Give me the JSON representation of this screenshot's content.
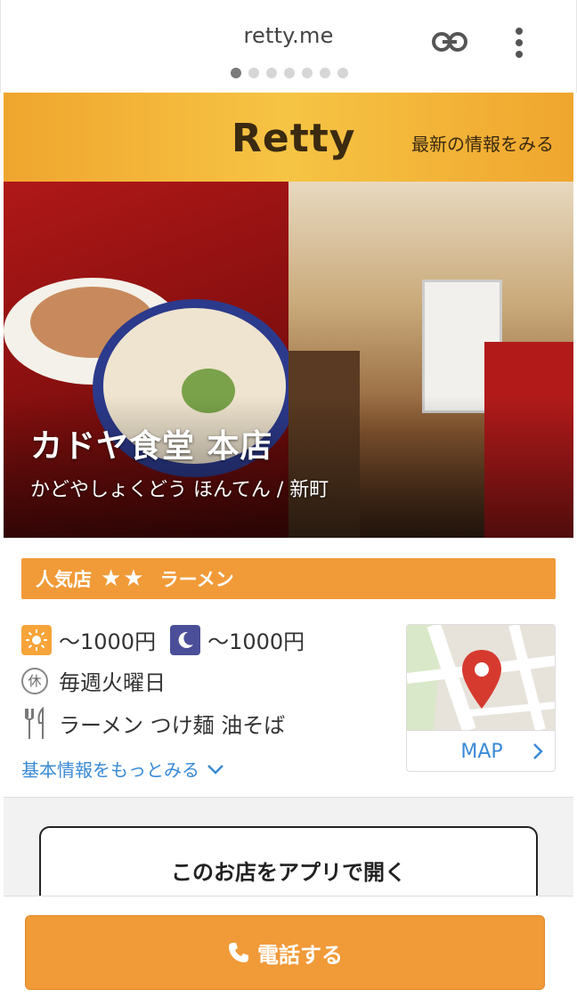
{
  "browser": {
    "url": "retty.me",
    "page_dots_count": 7,
    "active_dot_index": 0
  },
  "header": {
    "logo": "Retty",
    "latest_link": "最新の情報をみる"
  },
  "hero": {
    "shop_name": "カドヤ食堂 本店",
    "shop_kana": "かどやしょくどう ほんてん / 新町"
  },
  "badge": {
    "label": "人気店",
    "stars": "★★",
    "genre": "ラーメン"
  },
  "info": {
    "lunch_price": "～1000円",
    "dinner_price": "～1000円",
    "closed_icon_char": "休",
    "closed_day": "毎週火曜日",
    "genres": "ラーメン つけ麺 油そば",
    "more_info": "基本情報をもっとみる"
  },
  "map": {
    "label": "MAP"
  },
  "actions": {
    "open_in_app": "このお店をアプリで開く",
    "call": "電話する"
  },
  "colors": {
    "brand_orange": "#f19a38",
    "header_yellow": "#f6c444",
    "link_blue": "#3a8ad6",
    "moon_blue": "#4b4e98",
    "map_pin_red": "#d63a2f"
  },
  "icons": [
    "link-icon",
    "more-vert-icon",
    "sun-icon",
    "moon-icon",
    "closed-icon",
    "fork-knife-icon",
    "chevron-down-icon",
    "map-pin-icon",
    "chevron-right-icon",
    "phone-icon"
  ]
}
